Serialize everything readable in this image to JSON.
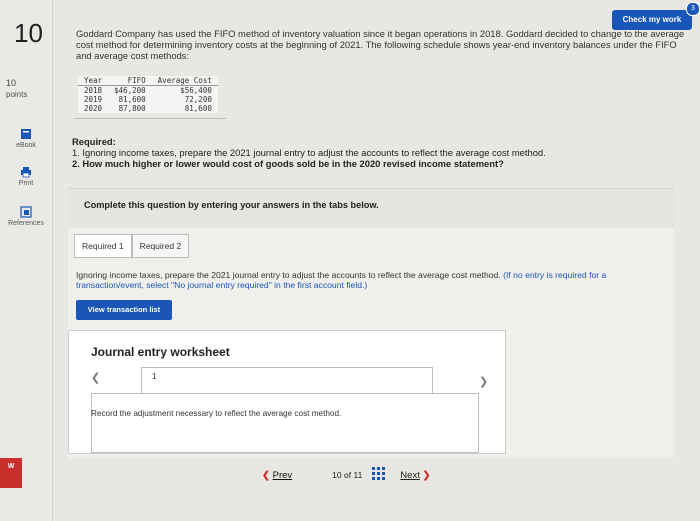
{
  "question": {
    "number": "10",
    "points_value": "10",
    "points_label": "points"
  },
  "sidebar": {
    "tools": [
      {
        "label": "eBook",
        "icon": "book-icon"
      },
      {
        "label": "Print",
        "icon": "printer-icon"
      },
      {
        "label": "References",
        "icon": "references-icon"
      }
    ],
    "bottom_badge": "W"
  },
  "header": {
    "check_label": "Check my work",
    "check_badge": "3"
  },
  "intro_text": "Goddard Company has used the FIFO method of inventory valuation since it began operations in 2018. Goddard decided to change to the average cost method for determining inventory costs at the beginning of 2021. The following schedule shows year-end inventory balances under the FIFO and average cost methods:",
  "schedule": {
    "headers": [
      "Year",
      "FIFO",
      "Average Cost"
    ],
    "rows": [
      [
        "2018",
        "$46,200",
        "$56,400"
      ],
      [
        "2019",
        "81,600",
        "72,200"
      ],
      [
        "2020",
        "87,800",
        "81,600"
      ]
    ]
  },
  "required": {
    "heading": "Required:",
    "items": [
      "1. Ignoring income taxes, prepare the 2021 journal entry to adjust the accounts to reflect the average cost method.",
      "2. How much higher or lower would cost of goods sold be in the 2020 revised income statement?"
    ]
  },
  "banner": "Complete this question by entering your answers in the tabs below.",
  "tabs": [
    {
      "label": "Required 1",
      "active": true
    },
    {
      "label": "Required 2",
      "active": false
    }
  ],
  "instructions": {
    "main": "Ignoring income taxes, prepare the 2021 journal entry to adjust the accounts to reflect the average cost method.",
    "note": "(If no entry is required for a transaction/event, select \"No journal entry required\" in the first account field.)"
  },
  "view_button": "View transaction list",
  "worksheet": {
    "title": "Journal entry worksheet",
    "page": "1",
    "record_text": "Record the adjustment necessary to reflect the average cost method."
  },
  "pager": {
    "prev": "Prev",
    "current": "10",
    "of": "of",
    "total": "11",
    "next": "Next"
  }
}
